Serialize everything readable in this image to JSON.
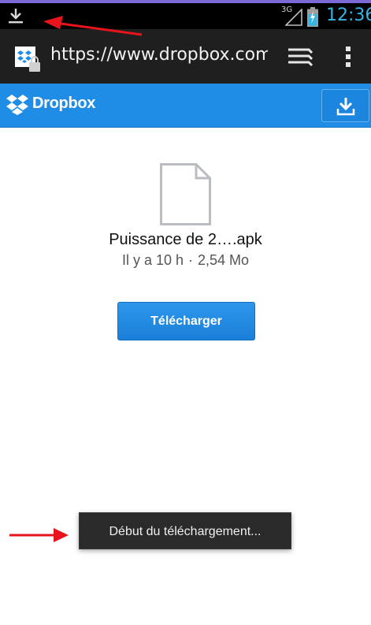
{
  "status_bar": {
    "network": "3G",
    "time": "12:36",
    "icons": [
      "download-icon",
      "signal-icon",
      "battery-charging-icon"
    ]
  },
  "browser": {
    "url": "https://www.dropbox.com",
    "icons": [
      "lock-favicon-icon",
      "tabs-icon",
      "overflow-menu-icon"
    ]
  },
  "dropbox": {
    "brand": "Dropbox",
    "header_icons": [
      "dropbox-logo-icon",
      "download-icon"
    ],
    "file": {
      "name": "Puissance de 2….apk",
      "age": "Il y a 10 h",
      "separator": "·",
      "size": "2,54  Mo",
      "icon": "file-icon"
    },
    "download_label": "Télécharger"
  },
  "toast": {
    "message": "Début du téléchargement..."
  },
  "colors": {
    "accent_status": "#33b5e5",
    "dropbox_blue": "#1f8ce6",
    "annotation_red": "#e8141b"
  }
}
